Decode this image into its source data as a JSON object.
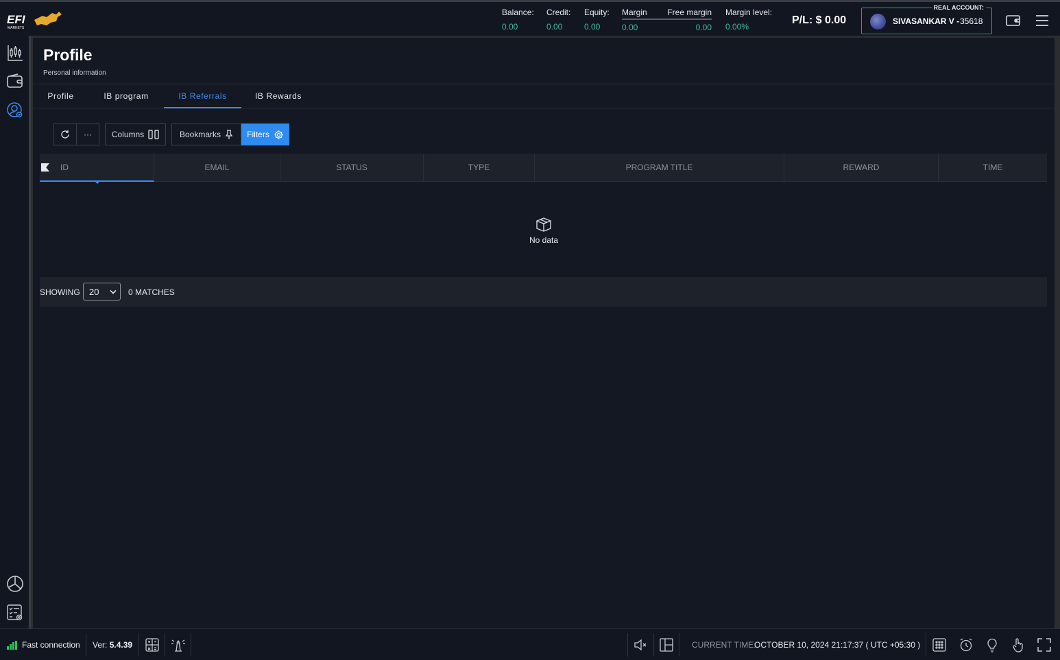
{
  "header": {
    "logo_text": "EFI MARKETS",
    "stats": [
      {
        "label": "Balance:",
        "value": "0.00"
      },
      {
        "label": "Credit:",
        "value": "0.00"
      },
      {
        "label": "Equity:",
        "value": "0.00"
      }
    ],
    "margin": {
      "label": "Margin",
      "value": "0.00"
    },
    "free_margin": {
      "label": "Free margin",
      "value": "0.00"
    },
    "margin_level": {
      "label": "Margin level:",
      "value": "0.00%"
    },
    "pl_label": "P/L:",
    "pl_value": "$ 0.00",
    "account": {
      "tag": "REAL ACCOUNT:",
      "name": "SIVASANKAR V -",
      "number": "35618"
    }
  },
  "page": {
    "title": "Profile",
    "subtitle": "Personal information"
  },
  "tabs": [
    {
      "label": "Profile"
    },
    {
      "label": "IB program"
    },
    {
      "label": "IB Referrals",
      "active": true
    },
    {
      "label": "IB Rewards"
    }
  ],
  "toolbar": {
    "more_label": "···",
    "columns_label": "Columns",
    "bookmarks_label": "Bookmarks",
    "filters_label": "Filters"
  },
  "table": {
    "columns": [
      "ID",
      "EMAIL",
      "STATUS",
      "TYPE",
      "PROGRAM TITLE",
      "REWARD",
      "TIME"
    ],
    "empty_text": "No data"
  },
  "pager": {
    "showing_label": "SHOWING",
    "page_size": "20",
    "matches_label": "0 MATCHES"
  },
  "status_bar": {
    "connection": "Fast connection",
    "version_label": "Ver:",
    "version_value": "5.4.39",
    "time_label": "CURRENT TIME:",
    "time_value": "OCTOBER 10, 2024 21:17:37 ( UTC +05:30 )"
  },
  "colors": {
    "accent_blue": "#2e8bf0",
    "value_green": "#3fb9a3",
    "signal_green": "#2ec45a"
  }
}
